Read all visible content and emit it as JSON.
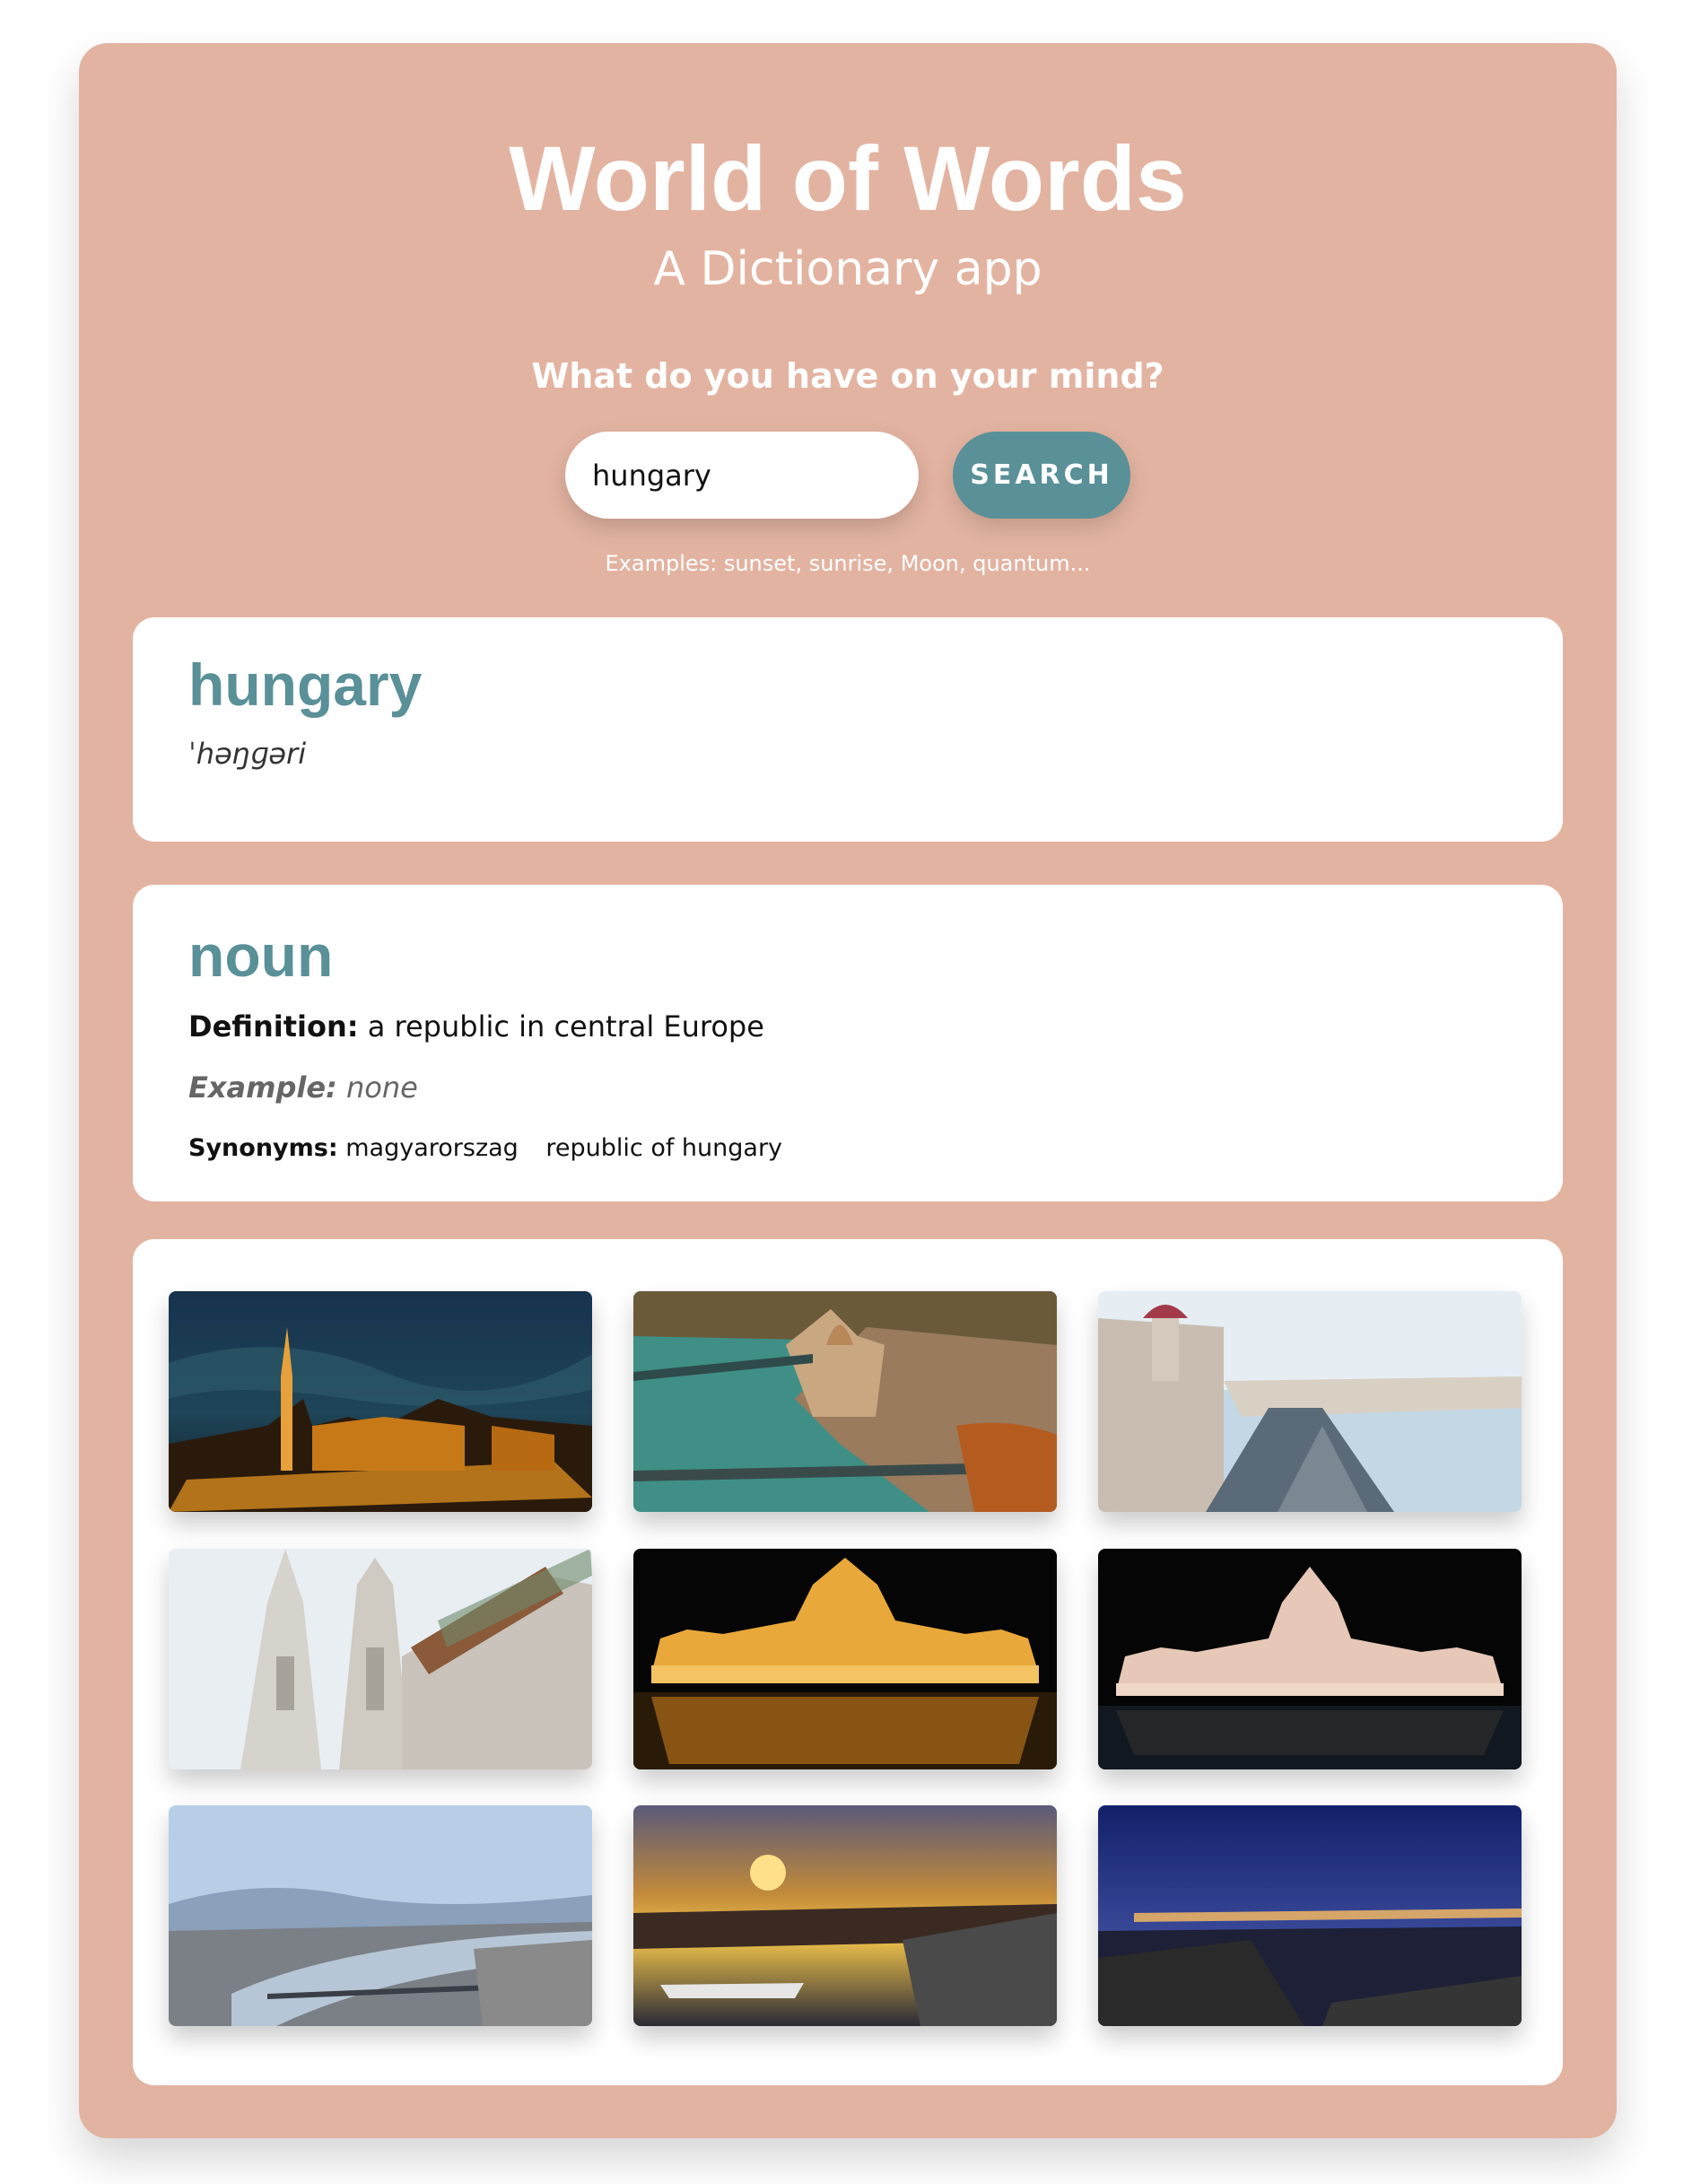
{
  "header": {
    "title": "World of Words",
    "subtitle": "A Dictionary app",
    "prompt": "What do you have on your mind?"
  },
  "search": {
    "value": "hungary",
    "button_label": "SEARCH",
    "examples": "Examples: sunset, sunrise, Moon, quantum..."
  },
  "result": {
    "word": "hungary",
    "phonetic": "ˈhəŋɡəri"
  },
  "meaning": {
    "part_of_speech": "noun",
    "definition_label": "Definition:",
    "definition": "a republic in central Europe",
    "example_label": "Example:",
    "example": "none",
    "synonyms_label": "Synonyms:",
    "synonyms": [
      "magyarorszag",
      "republic of hungary"
    ]
  },
  "photos": [
    {
      "subject": "matthias-church-night"
    },
    {
      "subject": "danube-aerial-autumn"
    },
    {
      "subject": "parliament-riverside-road"
    },
    {
      "subject": "matthias-church-facade"
    },
    {
      "subject": "parliament-night-reflection"
    },
    {
      "subject": "parliament-night-dark"
    },
    {
      "subject": "budapest-panorama-bridges"
    },
    {
      "subject": "danube-sunset-boat"
    },
    {
      "subject": "bridge-twilight-shore"
    }
  ],
  "colors": {
    "background": "#e3b3a1",
    "accent": "#5a9098",
    "card": "#ffffff"
  }
}
